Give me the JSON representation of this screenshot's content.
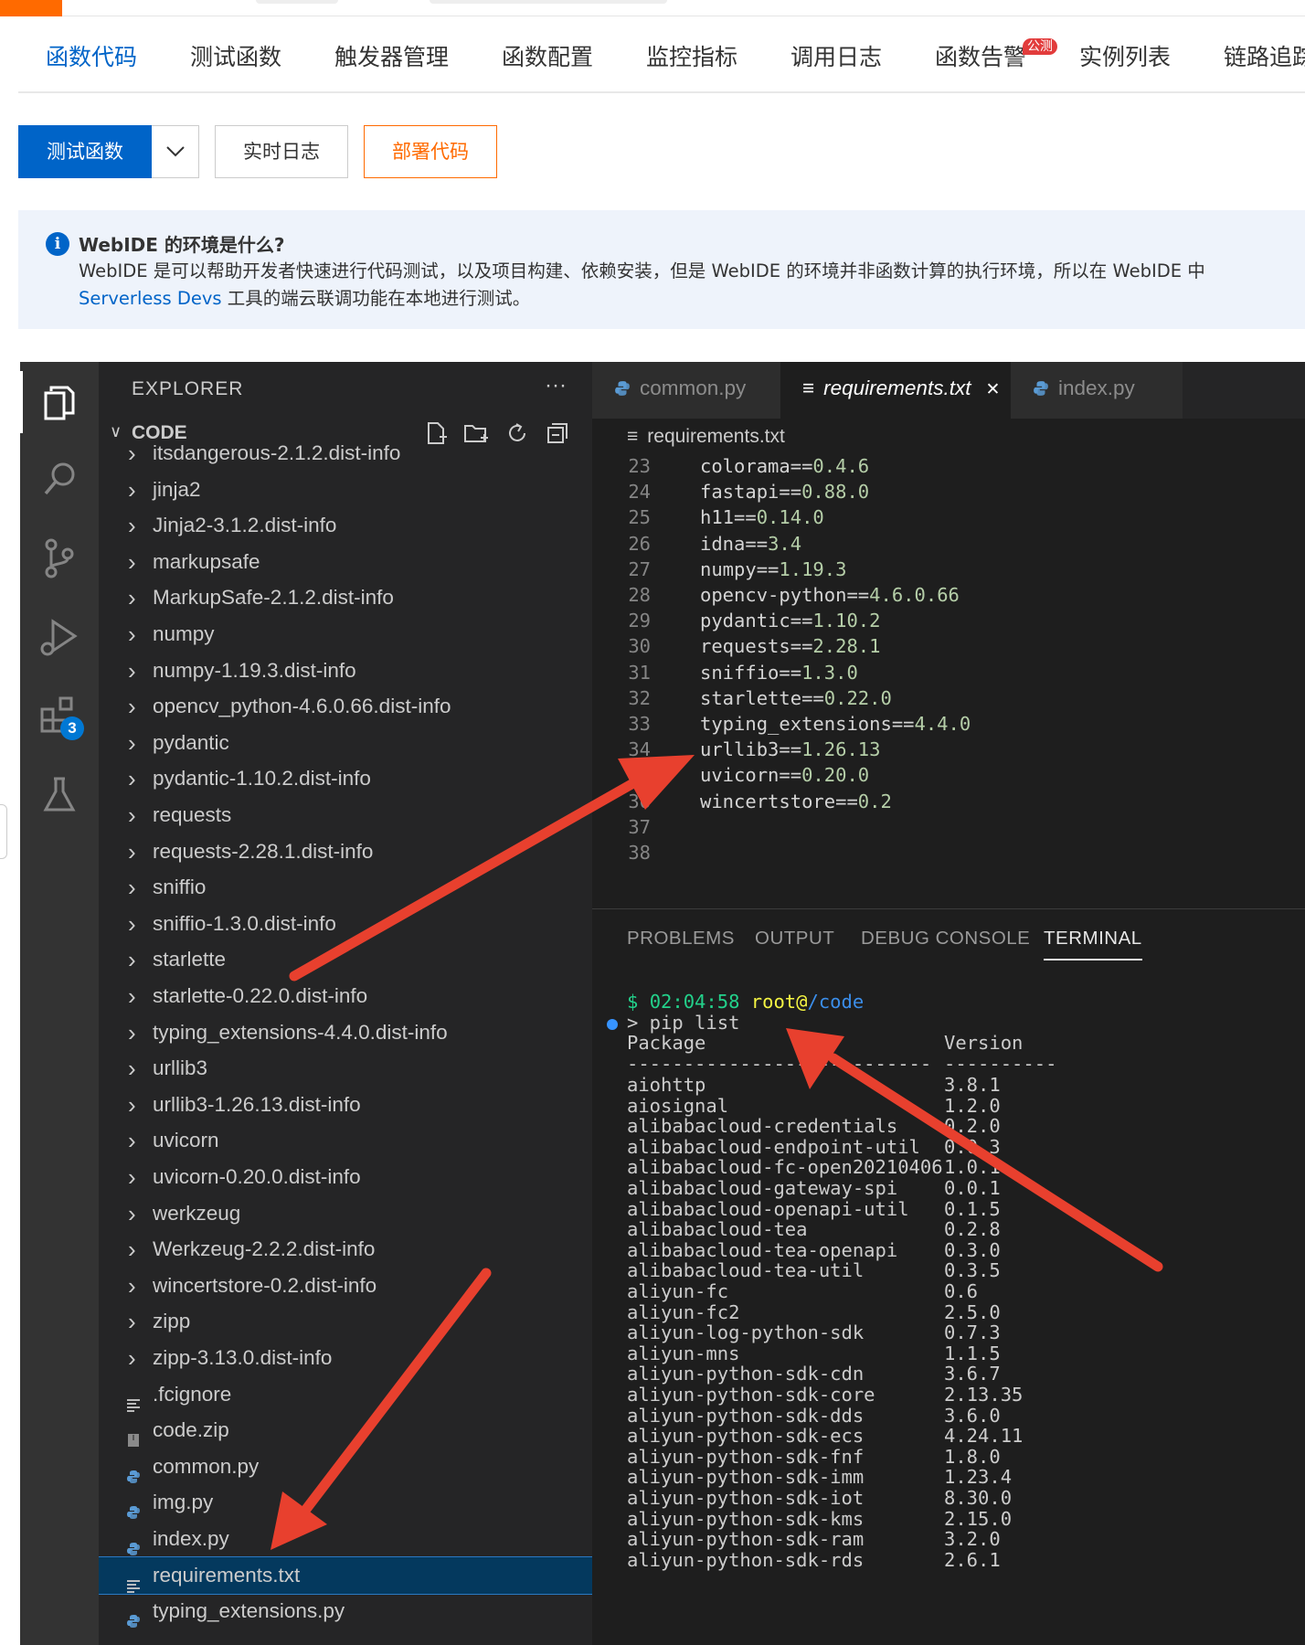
{
  "tabs": [
    {
      "label": "函数代码",
      "active": true
    },
    {
      "label": "测试函数"
    },
    {
      "label": "触发器管理"
    },
    {
      "label": "函数配置"
    },
    {
      "label": "监控指标"
    },
    {
      "label": "调用日志"
    },
    {
      "label": "函数告警",
      "badge": "公测"
    },
    {
      "label": "实例列表"
    },
    {
      "label": "链路追踪"
    }
  ],
  "toolbar": {
    "test": "测试函数",
    "logs": "实时日志",
    "deploy": "部署代码"
  },
  "notice": {
    "title": "WebIDE 的环境是什么?",
    "line1": "WebIDE 是可以帮助开发者快速进行代码测试，以及项目构建、依赖安装，但是 WebIDE 的环境并非函数计算的执行环境，所以在 WebIDE 中",
    "link": "Serverless Devs",
    "line2": " 工具的端云联调功能在本地进行测试。"
  },
  "activity": {
    "extensions_badge": "3"
  },
  "sidebar": {
    "title": "EXPLORER",
    "more": "···",
    "section": "CODE",
    "items": [
      {
        "name": "itsdangerous-2.1.2.dist-info",
        "type": "folder"
      },
      {
        "name": "jinja2",
        "type": "folder"
      },
      {
        "name": "Jinja2-3.1.2.dist-info",
        "type": "folder"
      },
      {
        "name": "markupsafe",
        "type": "folder"
      },
      {
        "name": "MarkupSafe-2.1.2.dist-info",
        "type": "folder"
      },
      {
        "name": "numpy",
        "type": "folder"
      },
      {
        "name": "numpy-1.19.3.dist-info",
        "type": "folder"
      },
      {
        "name": "opencv_python-4.6.0.66.dist-info",
        "type": "folder"
      },
      {
        "name": "pydantic",
        "type": "folder"
      },
      {
        "name": "pydantic-1.10.2.dist-info",
        "type": "folder"
      },
      {
        "name": "requests",
        "type": "folder"
      },
      {
        "name": "requests-2.28.1.dist-info",
        "type": "folder"
      },
      {
        "name": "sniffio",
        "type": "folder"
      },
      {
        "name": "sniffio-1.3.0.dist-info",
        "type": "folder"
      },
      {
        "name": "starlette",
        "type": "folder"
      },
      {
        "name": "starlette-0.22.0.dist-info",
        "type": "folder"
      },
      {
        "name": "typing_extensions-4.4.0.dist-info",
        "type": "folder"
      },
      {
        "name": "urllib3",
        "type": "folder"
      },
      {
        "name": "urllib3-1.26.13.dist-info",
        "type": "folder"
      },
      {
        "name": "uvicorn",
        "type": "folder"
      },
      {
        "name": "uvicorn-0.20.0.dist-info",
        "type": "folder"
      },
      {
        "name": "werkzeug",
        "type": "folder"
      },
      {
        "name": "Werkzeug-2.2.2.dist-info",
        "type": "folder"
      },
      {
        "name": "wincertstore-0.2.dist-info",
        "type": "folder"
      },
      {
        "name": "zipp",
        "type": "folder"
      },
      {
        "name": "zipp-3.13.0.dist-info",
        "type": "folder"
      },
      {
        "name": ".fcignore",
        "type": "text"
      },
      {
        "name": "code.zip",
        "type": "zip"
      },
      {
        "name": "common.py",
        "type": "py"
      },
      {
        "name": "img.py",
        "type": "py"
      },
      {
        "name": "index.py",
        "type": "py"
      },
      {
        "name": "requirements.txt",
        "type": "text",
        "selected": true
      },
      {
        "name": "typing_extensions.py",
        "type": "py"
      }
    ]
  },
  "editor": {
    "tabs": [
      {
        "label": "common.py",
        "type": "py"
      },
      {
        "label": "requirements.txt",
        "type": "text",
        "active": true
      },
      {
        "label": "index.py",
        "type": "py"
      }
    ],
    "breadcrumb": "requirements.txt",
    "lines": [
      {
        "n": "23",
        "pkg": "colorama==",
        "ver": "0.4.6"
      },
      {
        "n": "24",
        "pkg": "fastapi==",
        "ver": "0.88.0"
      },
      {
        "n": "25",
        "pkg": "h11==",
        "ver": "0.14.0"
      },
      {
        "n": "26",
        "pkg": "idna==",
        "ver": "3.4"
      },
      {
        "n": "27",
        "pkg": "numpy==",
        "ver": "1.19.3"
      },
      {
        "n": "28",
        "pkg": "opencv-python==",
        "ver": "4.6.0.66"
      },
      {
        "n": "29",
        "pkg": "pydantic==",
        "ver": "1.10.2"
      },
      {
        "n": "30",
        "pkg": "requests==",
        "ver": "2.28.1"
      },
      {
        "n": "31",
        "pkg": "sniffio==",
        "ver": "1.3.0"
      },
      {
        "n": "32",
        "pkg": "starlette==",
        "ver": "0.22.0"
      },
      {
        "n": "33",
        "pkg": "typing_extensions==",
        "ver": "4.4.0"
      },
      {
        "n": "34",
        "pkg": "urllib3==",
        "ver": "1.26.13"
      },
      {
        "n": "35",
        "pkg": "uvicorn==",
        "ver": "0.20.0"
      },
      {
        "n": "36",
        "pkg": "wincertstore==",
        "ver": "0.2"
      },
      {
        "n": "37",
        "pkg": "",
        "ver": ""
      },
      {
        "n": "38",
        "pkg": "",
        "ver": ""
      }
    ]
  },
  "panel": {
    "tabs": [
      {
        "label": "PROBLEMS"
      },
      {
        "label": "OUTPUT"
      },
      {
        "label": "DEBUG CONSOLE"
      },
      {
        "label": "TERMINAL",
        "active": true
      }
    ],
    "prompt": {
      "dollar": "$",
      "time": "02:04:58",
      "user": "root@",
      "path": "/code"
    },
    "command": "> pip list",
    "header": {
      "package": "Package",
      "version": "Version"
    },
    "rule_pkg": "---------------------------",
    "rule_ver": "----------",
    "packages": [
      [
        "aiohttp",
        "3.8.1"
      ],
      [
        "aiosignal",
        "1.2.0"
      ],
      [
        "alibabacloud-credentials",
        "0.2.0"
      ],
      [
        "alibabacloud-endpoint-util",
        "0.0.3"
      ],
      [
        "alibabacloud-fc-open20210406",
        "1.0.1"
      ],
      [
        "alibabacloud-gateway-spi",
        "0.0.1"
      ],
      [
        "alibabacloud-openapi-util",
        "0.1.5"
      ],
      [
        "alibabacloud-tea",
        "0.2.8"
      ],
      [
        "alibabacloud-tea-openapi",
        "0.3.0"
      ],
      [
        "alibabacloud-tea-util",
        "0.3.5"
      ],
      [
        "aliyun-fc",
        "0.6"
      ],
      [
        "aliyun-fc2",
        "2.5.0"
      ],
      [
        "aliyun-log-python-sdk",
        "0.7.3"
      ],
      [
        "aliyun-mns",
        "1.1.5"
      ],
      [
        "aliyun-python-sdk-cdn",
        "3.6.7"
      ],
      [
        "aliyun-python-sdk-core",
        "2.13.35"
      ],
      [
        "aliyun-python-sdk-dds",
        "3.6.0"
      ],
      [
        "aliyun-python-sdk-ecs",
        "4.24.11"
      ],
      [
        "aliyun-python-sdk-fnf",
        "1.8.0"
      ],
      [
        "aliyun-python-sdk-imm",
        "1.23.4"
      ],
      [
        "aliyun-python-sdk-iot",
        "8.30.0"
      ],
      [
        "aliyun-python-sdk-kms",
        "2.15.0"
      ],
      [
        "aliyun-python-sdk-ram",
        "3.2.0"
      ],
      [
        "aliyun-python-sdk-rds",
        "2.6.1"
      ]
    ]
  },
  "colors": {
    "accent": "#0064c8",
    "warn": "#ff6a00",
    "arrow": "#e8402e"
  }
}
